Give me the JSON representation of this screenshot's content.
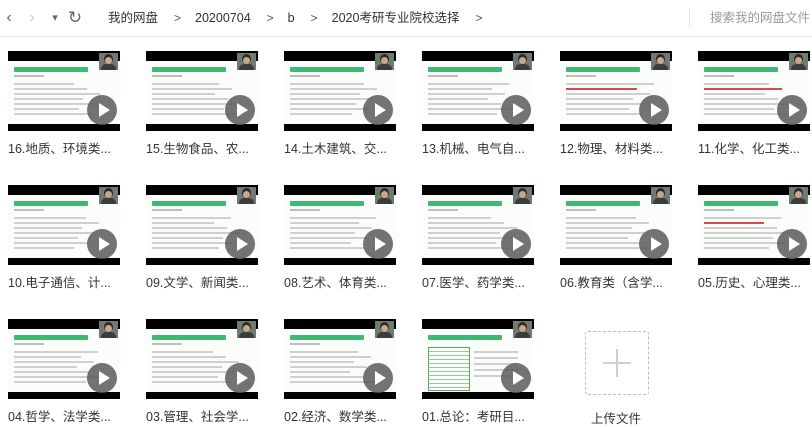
{
  "toolbar": {
    "back": "‹",
    "forward": "›",
    "dropdown": "▾",
    "refresh": "↻",
    "search_placeholder": "搜索我的网盘文件"
  },
  "breadcrumb": [
    "我的网盘",
    "20200704",
    "b",
    "2020考研专业院校选择"
  ],
  "breadcrumb_sep": ">",
  "files": [
    {
      "name": "16.地质、环境类..."
    },
    {
      "name": "15.生物食品、农..."
    },
    {
      "name": "14.土木建筑、交..."
    },
    {
      "name": "13.机械、电气自..."
    },
    {
      "name": "12.物理、材料类..."
    },
    {
      "name": "11.化学、化工类..."
    },
    {
      "name": "10.电子通信、计..."
    },
    {
      "name": "09.文学、新闻类..."
    },
    {
      "name": "08.艺术、体育类..."
    },
    {
      "name": "07.医学、药学类..."
    },
    {
      "name": "06.教育类（含学..."
    },
    {
      "name": "05.历史、心理类..."
    },
    {
      "name": "04.哲学、法学类..."
    },
    {
      "name": "03.管理、社会学..."
    },
    {
      "name": "02.经济、数学类..."
    },
    {
      "name": "01.总论：考研目..."
    }
  ],
  "upload": {
    "label": "上传文件"
  },
  "icons": [
    "back-icon",
    "forward-icon",
    "dropdown-icon",
    "refresh-icon",
    "play-icon",
    "plus-icon"
  ]
}
